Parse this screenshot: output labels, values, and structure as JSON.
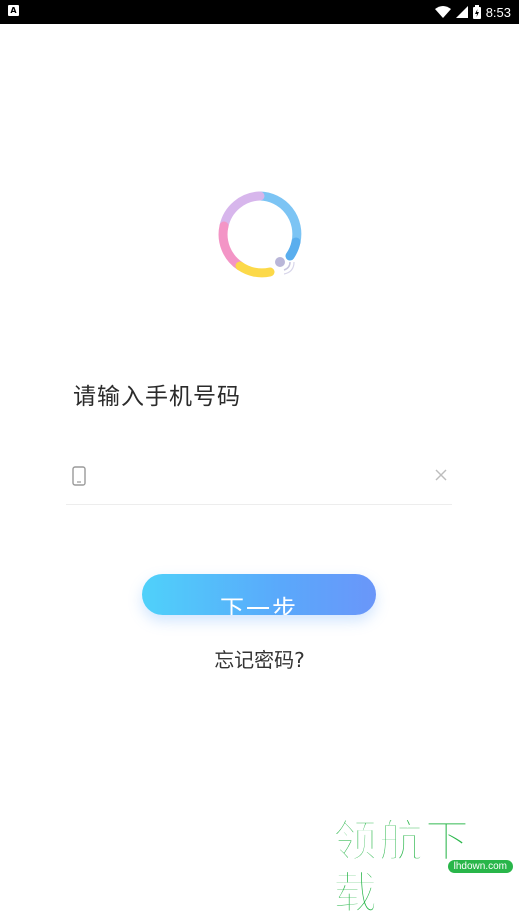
{
  "status_bar": {
    "app_icon_letter": "A",
    "time": "8:53"
  },
  "login": {
    "prompt": "请输入手机号码",
    "phone_input_value": "",
    "phone_input_placeholder": "",
    "next_button_label": "下一步",
    "forgot_password": "忘记密码?"
  },
  "watermark": {
    "text": "领航下载",
    "domain": "lhdown.com"
  },
  "colors": {
    "button_gradient_start": "#4fd1fa",
    "button_gradient_end": "#6a96f9",
    "watermark_green": "#29b64a"
  }
}
